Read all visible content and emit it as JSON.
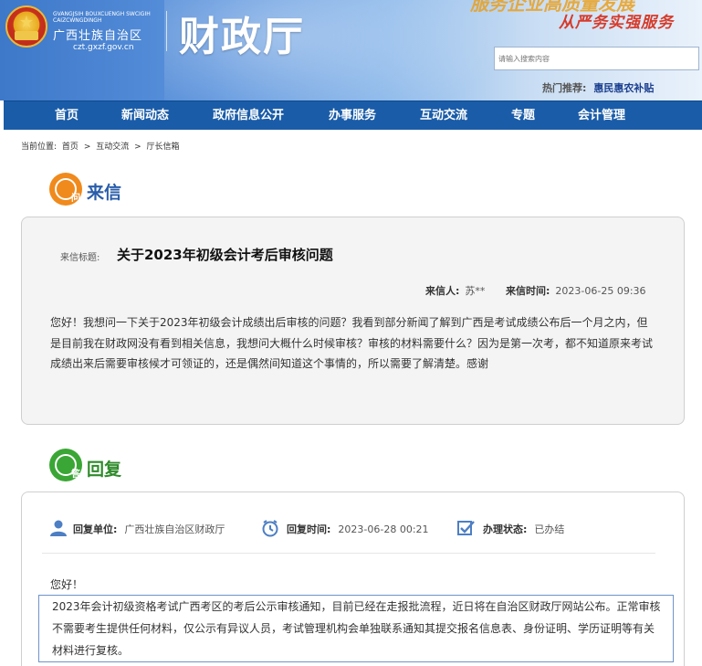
{
  "header": {
    "region_zh": "广西壮族自治区",
    "region_pinyin": "GVANGJSIH BOUXCUENGH SWCIGIH CAIZCWNGDINGH",
    "domain": "czt.gxzf.gov.cn",
    "site_title": "财政厅",
    "slogan_top": "服务企业高质量发展",
    "slogan_main": "从严务实强服务",
    "search_placeholder": "请输入搜索内容",
    "hot_label": "热门推荐:",
    "hot_value": "惠民惠农补贴"
  },
  "nav": [
    "首页",
    "新闻动态",
    "政府信息公开",
    "办事服务",
    "互动交流",
    "专题",
    "会计管理"
  ],
  "breadcrumb": {
    "label": "当前位置:",
    "items": [
      "首页",
      "互动交流",
      "厅长信箱"
    ],
    "sep": ">"
  },
  "letter": {
    "section_title": "来信",
    "icon_char": "问",
    "title_label": "来信标题:",
    "title": "关于2023年初级会计考后审核问题",
    "sender_label": "来信人:",
    "sender": "苏**",
    "time_label": "来信时间:",
    "time": "2023-06-25 09:36",
    "body": "您好！我想问一下关于2023年初级会计成绩出后审核的问题？我看到部分新闻了解到广西是考试成绩公布后一个月之内，但是目前我在财政网没有看到相关信息，我想问大概什么时候审核？审核的材料需要什么？因为是第一次考，都不知道原来考试成绩出来后需要审核候才可领证的，还是偶然间知道这个事情的，所以需要了解清楚。感谢"
  },
  "reply": {
    "section_title": "回复",
    "icon_char": "答",
    "unit_label": "回复单位:",
    "unit": "广西壮族自治区财政厅",
    "time_label": "回复时间:",
    "time": "2023-06-28 00:21",
    "status_label": "办理状态:",
    "status": "已办结",
    "greeting": "您好！",
    "body": "2023年会计初级资格考试广西考区的考后公示审核通知，目前已经在走报批流程，近日将在自治区财政厅网站公布。正常审核不需要考生提供任何材料，仅公示有异议人员，考试管理机构会单独联系通知其提交报名信息表、身份证明、学历证明等有关材料进行复核。"
  },
  "colors": {
    "nav_bg": "#1a5ca8",
    "letter_accent": "#f08a1c",
    "reply_accent": "#3aa635",
    "title_blue": "#2a5daa",
    "reply_green": "#2f8b2b"
  }
}
